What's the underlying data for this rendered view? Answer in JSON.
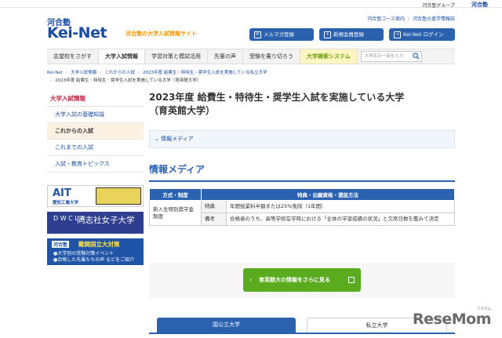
{
  "topbar": {
    "group_text": "河合塾グループ",
    "group_logo": "河合塾"
  },
  "header": {
    "logo_top": "河合塾",
    "logo_main": "Kei-Net",
    "tagline": "河合塾の大学入試情報サイト",
    "links": [
      "河合塾コース案内",
      "河合塾の進学情報誌"
    ],
    "buttons": [
      "メルマガ登録",
      "新規会員登録",
      "Kei-Net ログイン"
    ]
  },
  "nav": {
    "items": [
      "志望校をさがす",
      "大学入試情報",
      "学習対策と模試活用",
      "先輩の声",
      "受験を乗り切ろう",
      "大学検索システム"
    ],
    "search_placeholder": "大学名の一部を入力"
  },
  "breadcrumb": {
    "items": [
      "Kei-Net",
      "大学入試情報",
      "これからの入試",
      "2023年度 給費生・特待生・奨学生入試を実施している私立大学"
    ],
    "current": "2023年度 給費生・特待生・奨学生入試を実施している大学（育英館大学）"
  },
  "sidebar": {
    "heading": "大学入試情報",
    "items": [
      "大学入試の基礎知識",
      "これからの入試",
      "これまでの入試",
      "入試・教育トピックス"
    ]
  },
  "banners": {
    "ait": {
      "name": "AIT",
      "sub": "愛知工業大学"
    },
    "doshisha": {
      "mark": "D W C L A",
      "name": "同志社女子大学"
    },
    "kawaijuku": {
      "tag": "河合塾",
      "title": "難関国立大対策",
      "line1": "●大学別の受験対策イベント",
      "line2": "●合格した先輩たちの声 などをご紹介"
    }
  },
  "main": {
    "title_line1": "2023年度 給費生・特待生・奨学生入試を実施している大学",
    "title_line2": "（育英館大学）",
    "meta_label": "情報メディア",
    "section_title": "情報メディア",
    "table": {
      "headers": [
        "方式・制度",
        "特典・出願資格・選抜方法"
      ],
      "method": "新入生特別奨学金制度",
      "rows": [
        {
          "kind": "特典",
          "text": "年間授業料半額または25%免除（1年間）"
        },
        {
          "kind": "備考",
          "text": "合格者のうち、高等学校在学時における「全体の学習成績の状況」と欠席日数を鑑みて決定"
        }
      ]
    },
    "cta": "育英館大の情報をさらに見る",
    "tabs": [
      "国公立大学",
      "私立大学"
    ]
  },
  "watermark": {
    "text": "ReseMom",
    "small": "リセマム"
  },
  "colors": {
    "brand_blue": "#2a62b0",
    "cta_green": "#5aab1e",
    "accent_red": "#c41e3a"
  }
}
